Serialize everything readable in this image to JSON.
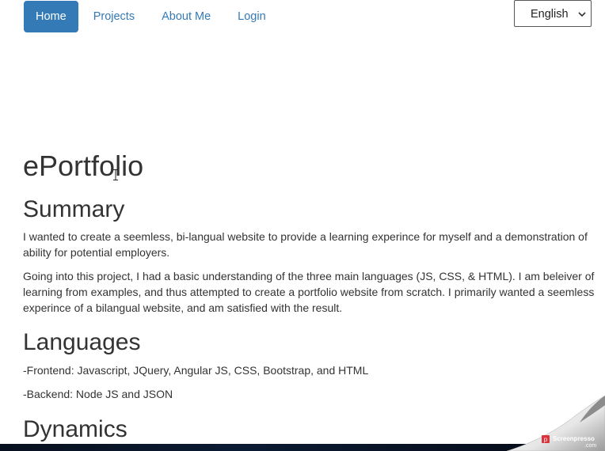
{
  "nav": {
    "items": [
      {
        "label": "Home"
      },
      {
        "label": "Projects"
      },
      {
        "label": "About Me"
      },
      {
        "label": "Login"
      }
    ]
  },
  "language_select": {
    "value": "English"
  },
  "page": {
    "title": "ePortfolio",
    "summary": {
      "heading": "Summary",
      "paragraphs": [
        "I wanted to create a seemless, bi-langual website to provide a learning experince for myself and a demonstration of ability for potential employers.",
        "Going into this project, I had a basic understanding of the three main languages (JS, CSS, & HTML). I am beleiver of learning from examples, and thus attempted to create a portfolio website from scratch. I primarily wanted a seemless experince of a bilangual website, and am satisfied with the result."
      ]
    },
    "languages": {
      "heading": "Languages",
      "frontend": "-Frontend: Javascript, JQuery, Angular JS, CSS, Bootstrap, and HTML",
      "backend": "-Backend: Node JS and JSON"
    },
    "dynamics": {
      "heading": "Dynamics"
    }
  },
  "watermark": {
    "brand": "Screenpresso",
    "domain": ".com"
  },
  "colors": {
    "accent": "#337ab7",
    "text": "#333333"
  }
}
